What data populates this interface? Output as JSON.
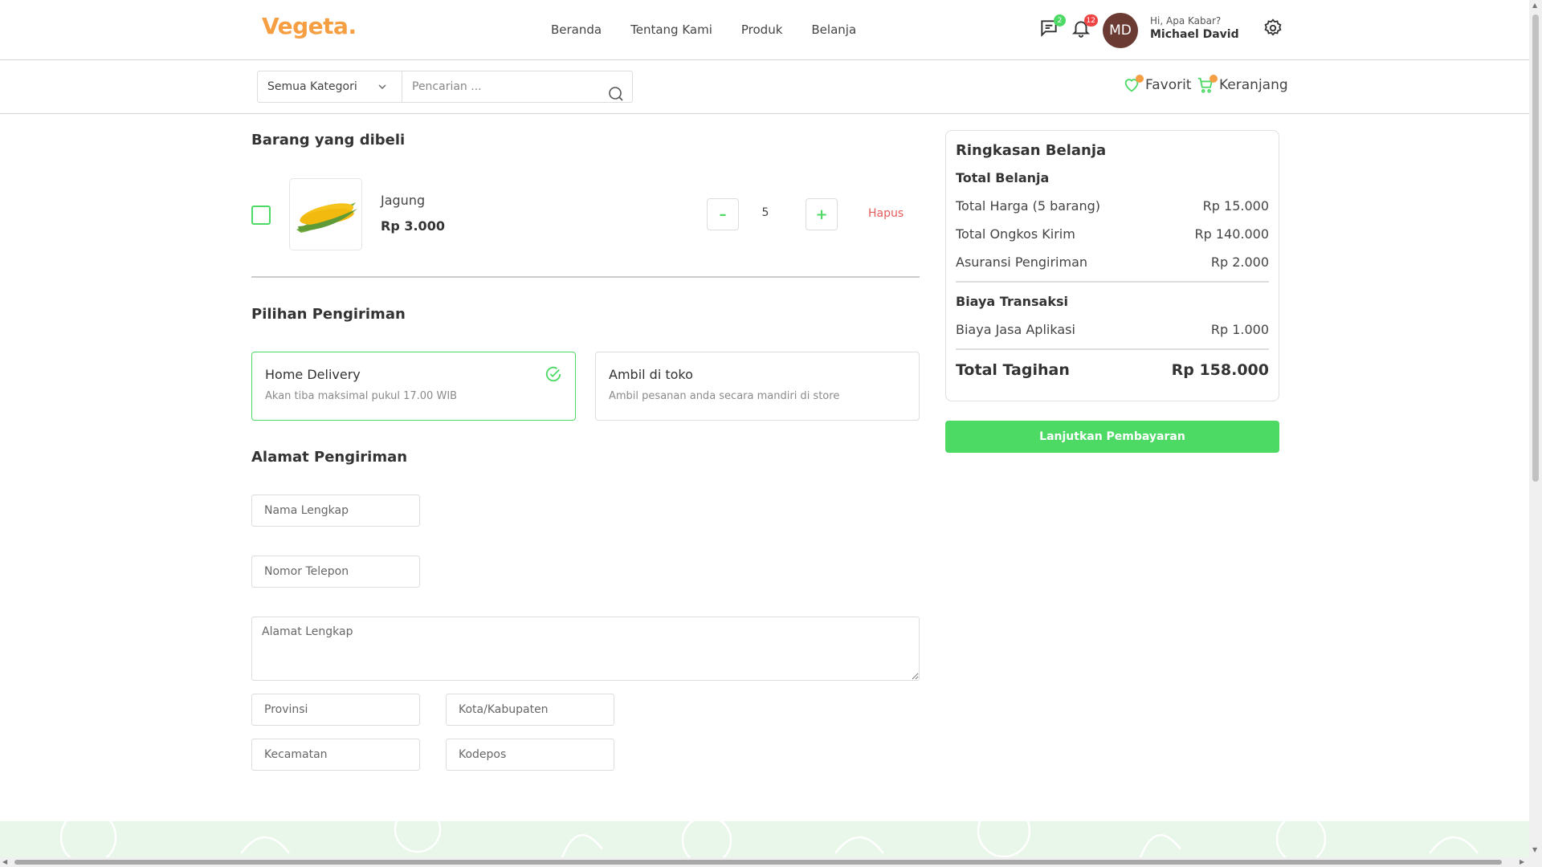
{
  "brand": {
    "logo": "Vegeta",
    "logo_dot": ".",
    "accent": "#4cd964",
    "logo_color": "#f59e42"
  },
  "nav": {
    "items": [
      "Beranda",
      "Tentang Kami",
      "Produk",
      "Belanja"
    ]
  },
  "header": {
    "chat_badge": "2",
    "notif_badge": "12",
    "avatar_initials": "MD",
    "greeting": "Hi, Apa Kabar?",
    "user_name": "Michael David"
  },
  "search": {
    "category": "Semua Kategori",
    "placeholder": "Pencarian ..."
  },
  "links": {
    "favorite": "Favorit",
    "cart": "Keranjang"
  },
  "cart": {
    "title": "Barang yang dibeli",
    "item": {
      "name": "Jagung",
      "price": "Rp 3.000",
      "quantity": "5",
      "remove": "Hapus"
    }
  },
  "shipping": {
    "title": "Pilihan Pengiriman",
    "options": [
      {
        "title": "Home Delivery",
        "subtitle": "Akan tiba maksimal pukul 17.00 WIB",
        "selected": true
      },
      {
        "title": "Ambil di toko",
        "subtitle": "Ambil pesanan anda secara mandiri di store",
        "selected": false
      }
    ]
  },
  "address": {
    "title": "Alamat Pengiriman",
    "full_name": "Nama Lengkap",
    "phone": "Nomor Telepon",
    "street": "Alamat Lengkap",
    "province": "Provinsi",
    "city": "Kota/Kabupaten",
    "district": "Kecamatan",
    "postal": "Kodepos"
  },
  "summary": {
    "title": "Ringkasan Belanja",
    "total_section": "Total Belanja",
    "rows": [
      {
        "label": "Total Harga (5 barang)",
        "value": "Rp 15.000"
      },
      {
        "label": "Total Ongkos Kirim",
        "value": "Rp 140.000"
      },
      {
        "label": "Asuransi Pengiriman",
        "value": "Rp 2.000"
      }
    ],
    "fee_section": "Biaya Transaksi",
    "fee_row": {
      "label": "Biaya Jasa Aplikasi",
      "value": "Rp 1.000"
    },
    "grand_label": "Total Tagihan",
    "grand_value": "Rp 158.000",
    "pay_button": "Lanjutkan Pembayaran"
  }
}
